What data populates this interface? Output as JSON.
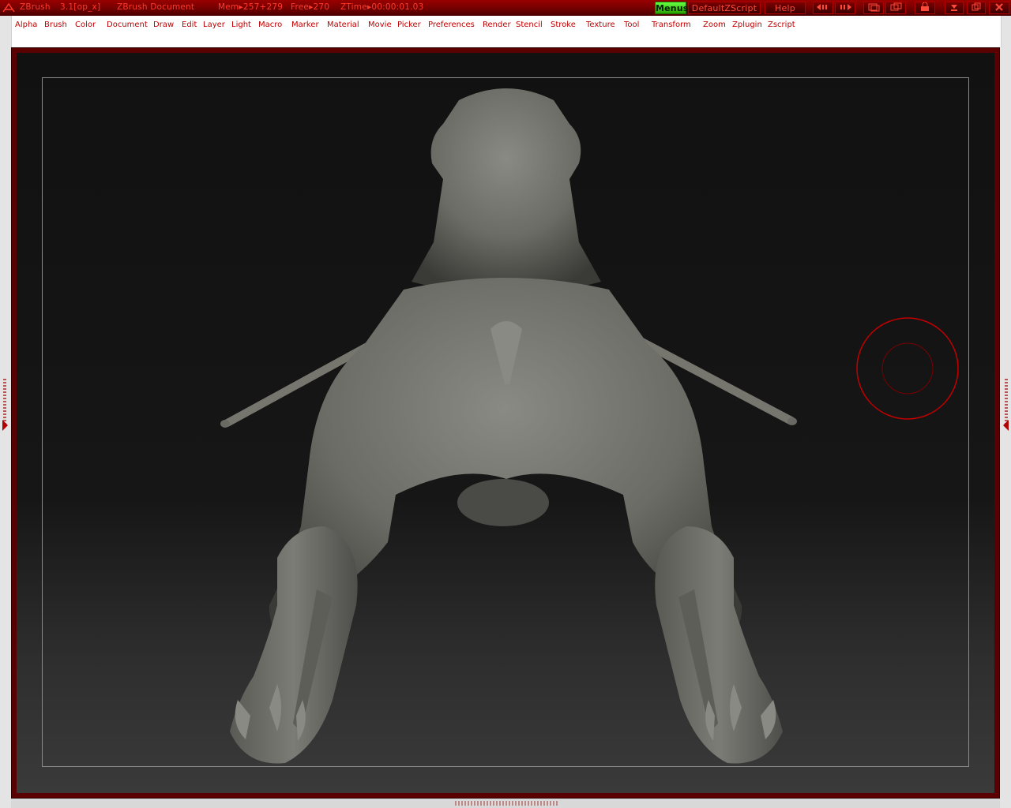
{
  "titlebar": {
    "app": "ZBrush",
    "version": "3.1[op_x]",
    "document": "ZBrush Document",
    "mem": "Mem▸257+279",
    "free": "Free▸270",
    "ztime": "ZTime▸00:00:01.03",
    "menus_btn": "Menus",
    "script_btn": "DefaultZScript",
    "help_btn": "Help"
  },
  "menu": {
    "items": [
      "Alpha",
      "Brush",
      "Color",
      "Document",
      "Draw",
      "Edit",
      "Layer",
      "Light",
      "Macro",
      "Marker",
      "Material",
      "Movie",
      "Picker",
      "Preferences",
      "Render",
      "Stencil",
      "Stroke",
      "Texture",
      "Tool",
      "Transform",
      "Zoom",
      "Zplugin",
      "Zscript"
    ]
  },
  "colors": {
    "accent": "#cc0000",
    "title_bg": "#7a0000",
    "menu_text": "#c00000",
    "menus_button": "#44dd22",
    "canvas_bg": "#141414",
    "model": "#6e6e68"
  },
  "icons": [
    "zbrush-logo-icon",
    "prev-icon",
    "next-icon",
    "layout-icon",
    "restore-icon",
    "lock-icon",
    "minimize-icon",
    "maximize-icon",
    "close-icon",
    "brush-cursor-icon"
  ]
}
